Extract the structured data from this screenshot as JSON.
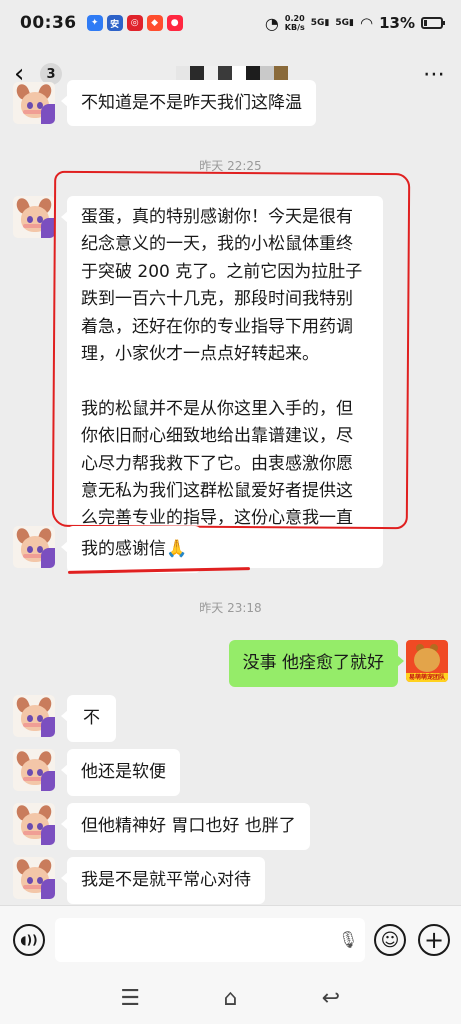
{
  "status_bar": {
    "time": "00:36",
    "network_speed_value": "0.20",
    "network_speed_unit": "KB/s",
    "signal_1": "5G",
    "signal_2": "5G",
    "battery": "13%"
  },
  "header": {
    "back_icon": "‹",
    "unread_count": "3",
    "more_icon": "⋯"
  },
  "messages": [
    {
      "side": "left",
      "text": "不知道是不是昨天我们这降温"
    },
    {
      "type": "timestamp",
      "text": "昨天 22:25"
    },
    {
      "side": "left",
      "text": "蛋蛋，真的特别感谢你！今天是很有纪念意义的一天，我的小松鼠体重终于突破 200 克了。之前它因为拉肚子跌到一百六十几克，那段时间我特别着急，还好在你的专业指导下用药调理，小家伙才一点点好转起来。\n\n我的松鼠并不是从你这里入手的，但你依旧耐心细致地给出靠谱建议，尽心尽力帮我救下了它。由衷感激你愿意无私为我们这群松鼠爱好者提供这么完善专业的指导，这份心意我一直记在心里！"
    },
    {
      "side": "left",
      "text": "我的感谢信🙏"
    },
    {
      "type": "timestamp",
      "text": "昨天 23:18"
    },
    {
      "side": "right",
      "text": "没事 他痊愈了就好"
    },
    {
      "side": "left",
      "text": "不"
    },
    {
      "side": "left",
      "text": "他还是软便"
    },
    {
      "side": "left",
      "text": "但他精神好 胃口也好 也胖了"
    },
    {
      "side": "left",
      "text": "我是不是就平常心对待"
    }
  ],
  "my_avatar_label": "易萌萌宠团队",
  "input": {
    "placeholder": ""
  },
  "icons": {
    "voice": "voice-icon",
    "mic": "mic-icon",
    "emoji": "emoji-icon",
    "plus": "plus-icon"
  },
  "colors": {
    "background": "#ededed",
    "bubble_left": "#ffffff",
    "bubble_right": "#95ec69",
    "annotation": "#e02020"
  }
}
